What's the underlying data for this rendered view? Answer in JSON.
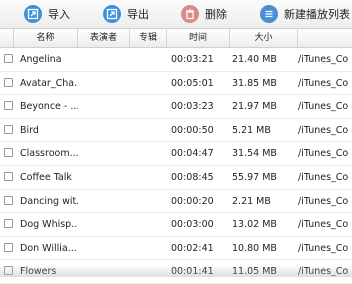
{
  "toolbar": {
    "import_label": "导入",
    "export_label": "导出",
    "delete_label": "删除",
    "new_playlist_label": "新建播放列表"
  },
  "table": {
    "headers": {
      "name": "名称",
      "artist": "表演者",
      "album": "专辑",
      "time": "时间",
      "size": "大小"
    },
    "rows": [
      {
        "name": "Angelina",
        "time": "00:03:21",
        "size": "21.40 MB",
        "path": "/iTunes_Co"
      },
      {
        "name": "Avatar_Cha...",
        "time": "00:05:01",
        "size": "31.85 MB",
        "path": "/iTunes_Co"
      },
      {
        "name": "Beyonce - ...",
        "time": "00:03:23",
        "size": "21.97 MB",
        "path": "/iTunes_Co"
      },
      {
        "name": "Bird",
        "time": "00:00:50",
        "size": "5.21 MB",
        "path": "/iTunes_Co"
      },
      {
        "name": "Classroom...",
        "time": "00:04:47",
        "size": "31.54 MB",
        "path": "/iTunes_Co"
      },
      {
        "name": "Coffee Talk",
        "time": "00:08:45",
        "size": "55.97 MB",
        "path": "/iTunes_Co"
      },
      {
        "name": "Dancing wit...",
        "time": "00:00:20",
        "size": "2.21 MB",
        "path": "/iTunes_Co"
      },
      {
        "name": "Dog Whisp...",
        "time": "00:03:00",
        "size": "13.02 MB",
        "path": "/iTunes_Co"
      },
      {
        "name": "Don Willia...",
        "time": "00:02:41",
        "size": "10.80 MB",
        "path": "/iTunes_Co"
      },
      {
        "name": "Flowers",
        "time": "00:01:41",
        "size": "11.05 MB",
        "path": "/iTunes_Co"
      }
    ]
  }
}
